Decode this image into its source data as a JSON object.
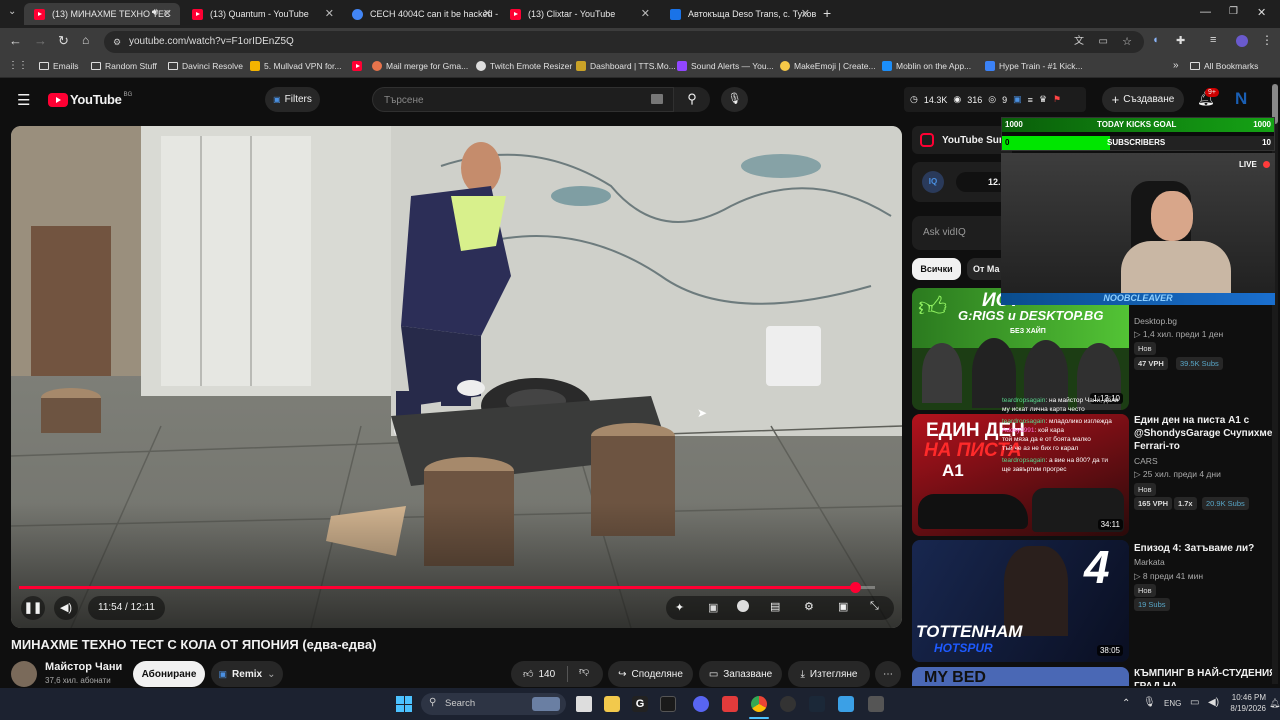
{
  "browser": {
    "tabs": [
      {
        "title": "(13) МИНАХМЕ ТЕХНО ТЕС",
        "type": "youtube",
        "active": true
      },
      {
        "title": "(13) Quantum - YouTube",
        "type": "youtube"
      },
      {
        "title": "CECH 4004C can it be hacked -",
        "type": "chrome"
      },
      {
        "title": "(13) Clixtar - YouTube",
        "type": "youtube"
      },
      {
        "title": "Автокъща Deso Trans, с. Тухов",
        "type": "site"
      }
    ],
    "new_tab": "+",
    "url": "youtube.com/watch?v=F1orIDEnZ5Q",
    "bookmarks": [
      {
        "label": "Emails",
        "icon": "folder-icon"
      },
      {
        "label": "Random Stuff",
        "icon": "folder-icon"
      },
      {
        "label": "Davinci Resolve",
        "icon": "folder-icon"
      },
      {
        "label": "5. Mullvad VPN for...",
        "icon": "mullvad-icon"
      },
      {
        "label": "",
        "icon": "youtube-icon"
      },
      {
        "label": "Mail merge for Gma...",
        "icon": "mail-icon"
      },
      {
        "label": "Twitch Emote Resizer",
        "icon": "twitch-icon"
      },
      {
        "label": "Dashboard | TTS.Mo...",
        "icon": "tts-icon"
      },
      {
        "label": "Sound Alerts — You...",
        "icon": "sound-icon"
      },
      {
        "label": "MakeEmoji | Create...",
        "icon": "emoji-icon"
      },
      {
        "label": "Moblin on the App...",
        "icon": "app-icon"
      },
      {
        "label": "Hype Train - #1 Kick...",
        "icon": "kick-icon"
      }
    ],
    "all_bookmarks": "All Bookmarks"
  },
  "youtube": {
    "logo": "YouTube",
    "region": "BG",
    "filters_label": "Filters",
    "search_placeholder": "Търсене",
    "stats": {
      "views": "14.3K",
      "eyes": "316",
      "subs": "9"
    },
    "create_label": "Създаване",
    "notifications": "9+",
    "avatar_letter": "N"
  },
  "player": {
    "time": "11:54 / 12:11",
    "progress": 0.977
  },
  "video": {
    "title": "МИНАХМЕ ТЕХНО ТЕСТ С КОЛА ОТ ЯПОНИЯ (едва-едва)",
    "channel": "Майстор Чани",
    "subscribers": "37,6 хил. абонати",
    "subscribe_label": "Абониране",
    "remix_label": "Remix",
    "likes": "140",
    "share_label": "Споделяне",
    "save_label": "Запазване",
    "download_label": "Изтегляне"
  },
  "sidebar": {
    "summary_label": "YouTube Sur",
    "vidiq_value": "12.",
    "ask_placeholder": "Ask vidIQ",
    "chips": [
      "Всички",
      "От Ма"
    ],
    "videos": [
      {
        "channel": "Desktop.bg",
        "meta": "1,4 хил.  преди 1 ден",
        "badge": "Нов",
        "vph": "47 VPH",
        "subs": "39.5K Subs",
        "duration": "1:13:10",
        "thumb_text": "ИСТ",
        "thumb_sub": "G:RIGS и DESKTOP.BG",
        "thumb_tag": "БЕЗ ХАЙП"
      },
      {
        "title": "Един ден на писта A1 с @ShondysGarage Счупихме Ferrari-то",
        "channel": "CARS",
        "meta": "25 хил.  преди 4 дни",
        "badge": "Нов",
        "vph": "165 VPH",
        "ratio": "1.7x",
        "subs": "20.9K Subs",
        "duration": "34:11",
        "thumb_text": "ЕДИН ДЕН",
        "thumb_sub": "НА ПИСТА",
        "thumb_tag": "A1"
      },
      {
        "title": "Епизод 4: Затъваме ли?",
        "channel": "Markata",
        "meta": "8  преди 41 мин",
        "badge": "Нов",
        "subs": "19 Subs",
        "duration": "38:05",
        "thumb_text": "4",
        "thumb_sub": "TOTTENHAM",
        "thumb_tag": "HOTSPUR"
      },
      {
        "title": "КЪМПИНГ В НАЙ-СТУДЕНИЯ ГРАД НА",
        "thumb_text": "MY BED"
      }
    ]
  },
  "overlay": {
    "goal_left": "1000",
    "goal_title": "TODAY KICKS GOAL",
    "goal_right": "1000",
    "subs_left": "0",
    "subs_title": "SUBSCRIBERS",
    "subs_right": "10",
    "live_label": "LIVE",
    "streamer_name": "NOOBCLEAVER",
    "chat": [
      {
        "user": "teardropsagain",
        "text": "на майстор Чани, дали"
      },
      {
        "user": "",
        "text": "му искат лична карта често"
      },
      {
        "user": "teardropsagain",
        "text": "младолико изглежда"
      },
      {
        "user": "Adoxy1991",
        "text": "кой кара"
      },
      {
        "user": "",
        "text": "той мяза да е от боята малко"
      },
      {
        "user": "",
        "text": "тъй че аз не бих го карал"
      },
      {
        "user": "teardropsagain",
        "text": "а вие на 800? да ти"
      },
      {
        "user": "",
        "text": "ще завъртим прогрес"
      }
    ]
  },
  "taskbar": {
    "search_placeholder": "Search",
    "lang": "ENG",
    "time": "10:46 PM",
    "date": "8/19/2026"
  },
  "colors": {
    "accent": "#ff0033",
    "goal_green": "#00e600"
  }
}
